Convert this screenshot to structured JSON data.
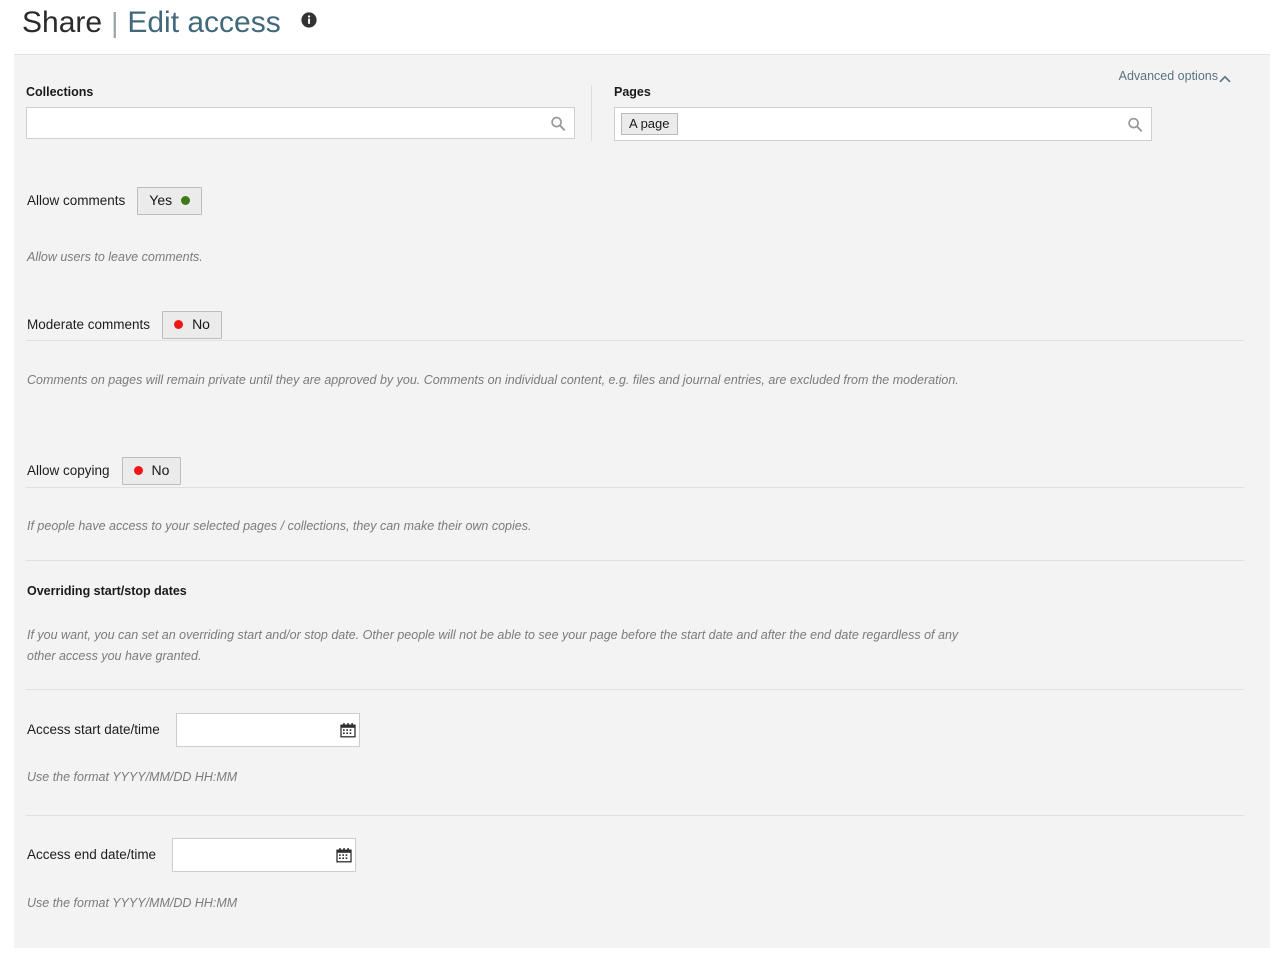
{
  "header": {
    "title": "Share",
    "separator": "|",
    "link": "Edit access",
    "info_icon": "info-circle-icon"
  },
  "panel": {
    "advanced_options": {
      "label": "Advanced options",
      "icon": "chevron-up-icon"
    },
    "selectors": {
      "collections": {
        "label": "Collections",
        "value": "",
        "placeholder": "",
        "icon": "search-icon"
      },
      "pages": {
        "label": "Pages",
        "chips": [
          "A page"
        ],
        "value": "",
        "placeholder": "",
        "icon": "search-icon"
      }
    },
    "fields": [
      {
        "label": "Allow comments",
        "toggle": "Yes",
        "toggle_state": "yes",
        "dot_color": "#3f7a18",
        "help": "Allow users to leave comments."
      },
      {
        "label": "Moderate comments",
        "toggle": "No",
        "toggle_state": "no",
        "dot_color": "#f01616",
        "help": "Comments on pages will remain private until they are approved by you. Comments on individual content, e.g. files and journal entries, are excluded from the moderation."
      },
      {
        "label": "Allow copying",
        "toggle": "No",
        "toggle_state": "no",
        "dot_color": "#f01616",
        "help": "If people have access to your selected pages / collections, they can make their own copies."
      }
    ],
    "overriding": {
      "heading": "Overriding start/stop dates",
      "help": "If you want, you can set an overriding start and/or stop date. Other people will not be able to see your page before the start date and after the end date regardless of any other access you have granted."
    },
    "dates": [
      {
        "label": "Access start date/time",
        "value": "",
        "placeholder": "",
        "help": "Use the format YYYY/MM/DD HH:MM",
        "icon": "calendar-icon"
      },
      {
        "label": "Access end date/time",
        "value": "",
        "placeholder": "",
        "help": "Use the format YYYY/MM/DD HH:MM",
        "icon": "calendar-icon"
      }
    ]
  },
  "colors": {
    "panel_bg": "#f3f3f3",
    "link": "#41697b",
    "advanced_link": "#5b7383",
    "help_text": "#7b7b7b",
    "yes_dot": "#3f7a18",
    "no_dot": "#f01616"
  }
}
